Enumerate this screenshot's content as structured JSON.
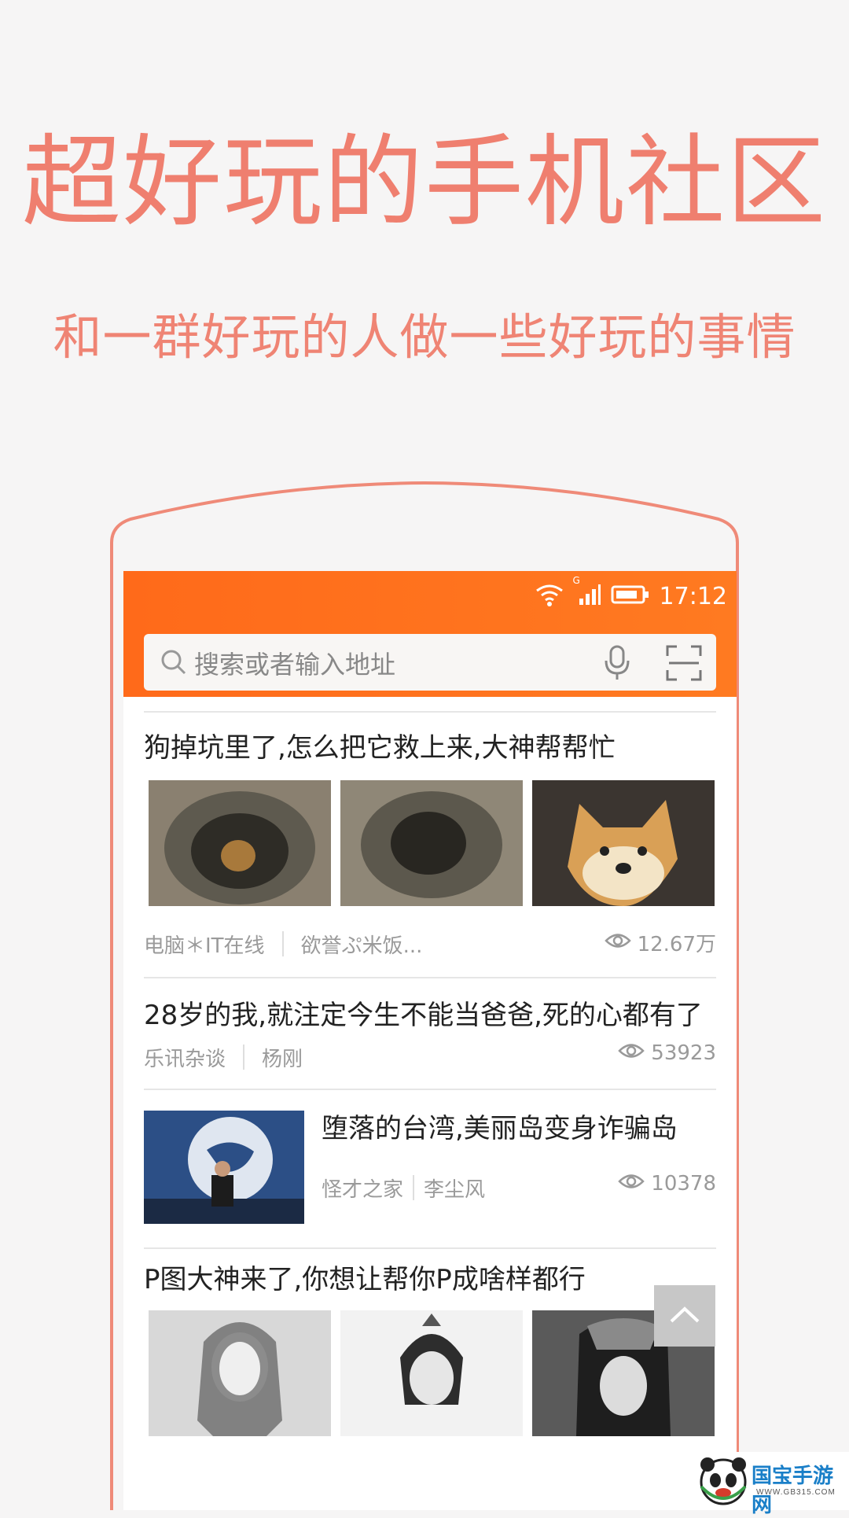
{
  "promo": {
    "headline": "超好玩的手机社区",
    "subline": "和一群好玩的人做一些好玩的事情"
  },
  "status_bar": {
    "time": "17:12",
    "signal_label": "G",
    "icons": [
      "wifi-icon",
      "signal-icon",
      "battery-icon"
    ]
  },
  "search": {
    "placeholder": "搜索或者输入地址",
    "icons": [
      "search-icon",
      "microphone-icon",
      "scan-icon"
    ]
  },
  "articles": [
    {
      "title": "狗掉坑里了,怎么把它救上来,大神帮帮忙",
      "source": "电脑＊IT在线",
      "author": "欲誉ぷ米饭...",
      "views": "12.67万"
    },
    {
      "title": "28岁的我,就注定今生不能当爸爸,死的心都有了",
      "source": "乐讯杂谈",
      "author": "杨刚",
      "views": "53923"
    },
    {
      "title": "堕落的台湾,美丽岛变身诈骗岛",
      "source": "怪才之家",
      "author": "李尘风",
      "views": "10378"
    },
    {
      "title": "P图大神来了,你想让帮你P成啥样都行"
    }
  ],
  "watermark": {
    "site_name": "国宝手游网",
    "site_url": "WWW.GB315.COM"
  },
  "colors": {
    "accent": "#ff6f1e",
    "headline": "#ef7f6f",
    "background": "#f6f5f5"
  }
}
